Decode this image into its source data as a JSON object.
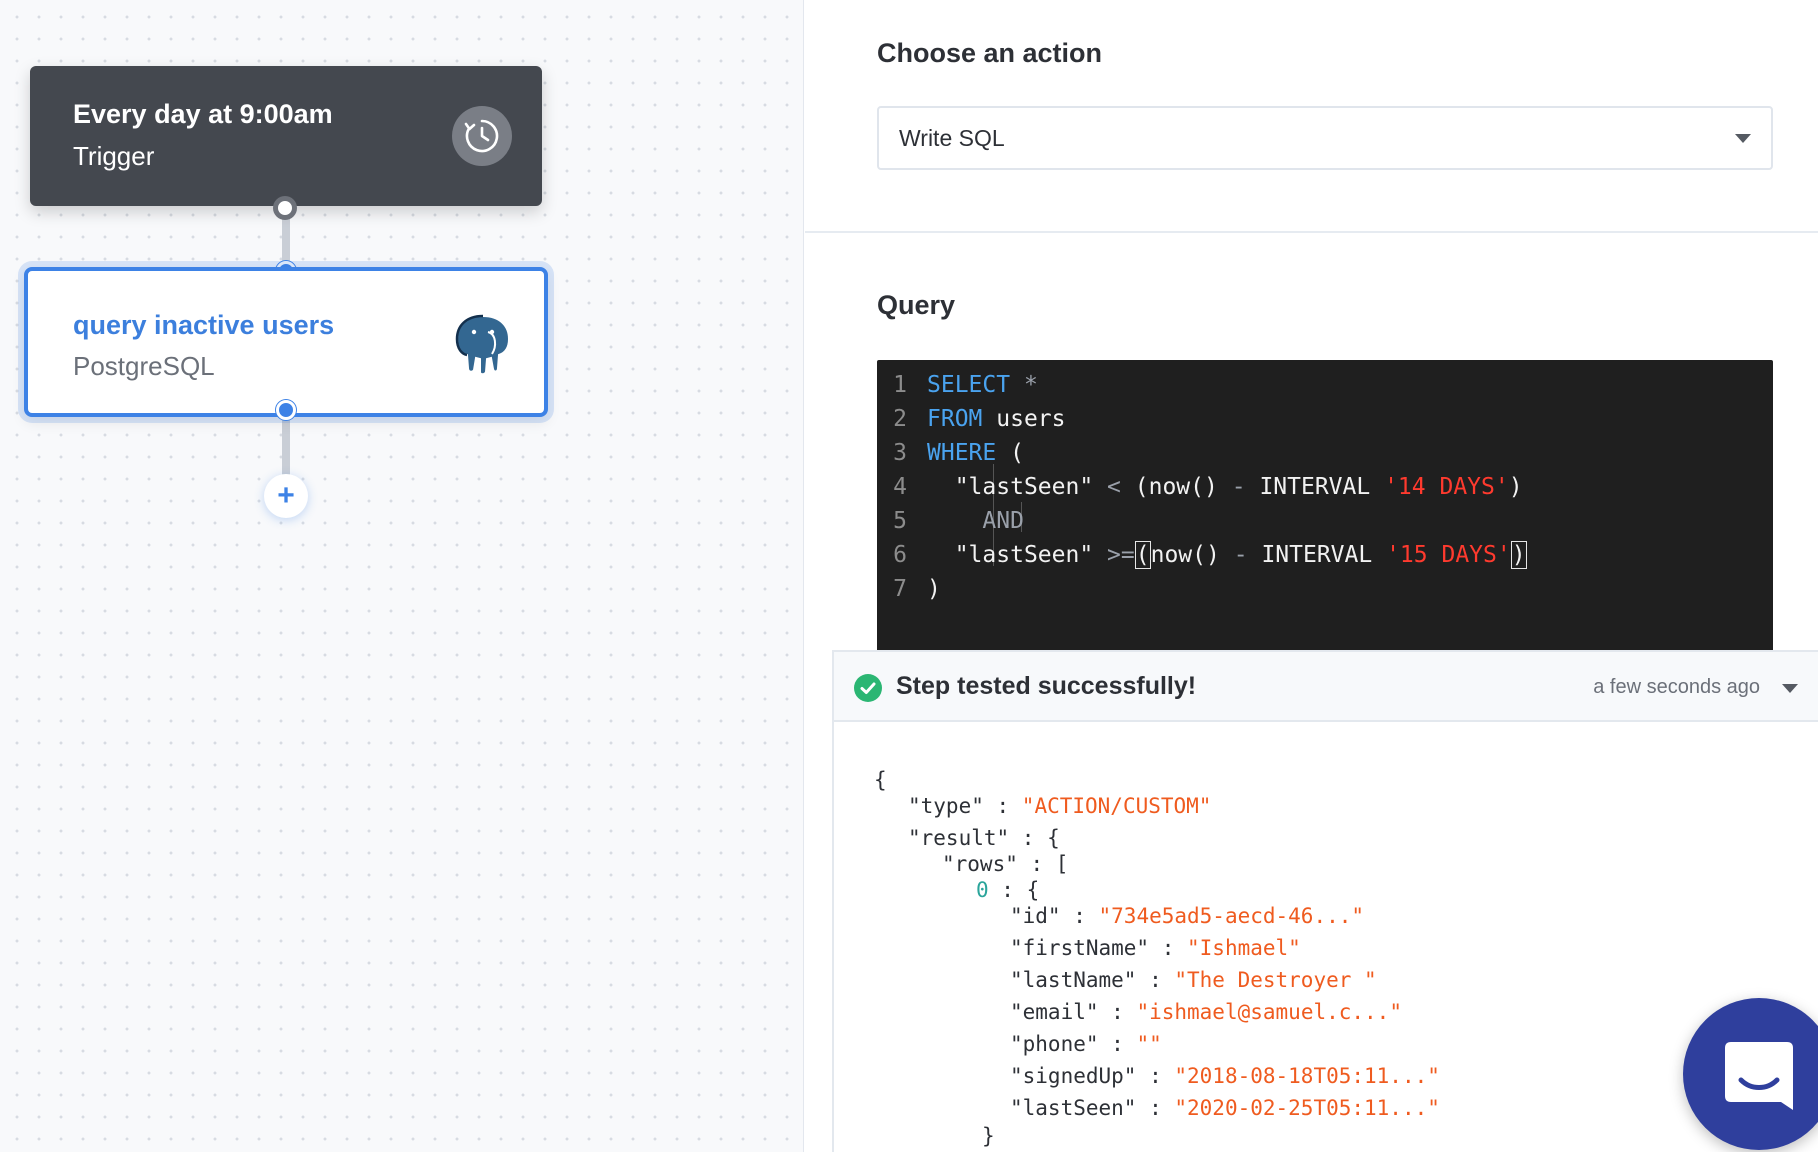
{
  "workflow": {
    "trigger": {
      "title": "Every day at 9:00am",
      "subtitle": "Trigger",
      "icon": "clock-icon"
    },
    "action": {
      "title": "query inactive users",
      "subtitle": "PostgreSQL",
      "icon": "postgresql-elephant-icon"
    },
    "add_step_icon": "+"
  },
  "panel": {
    "action_section_title": "Choose an action",
    "action_select_value": "Write SQL",
    "query_section_title": "Query",
    "code_line_numbers": [
      "1",
      "2",
      "3",
      "4",
      "5",
      "6",
      "7"
    ],
    "code": {
      "l1_kw": "SELECT",
      "l1_rest": "*",
      "l2_kw": "FROM",
      "l2_rest": "users",
      "l3_kw": "WHERE",
      "l3_rest": "(",
      "l4_col": "\"lastSeen\"",
      "l4_op": "<",
      "l4_expr": "(now()",
      "l4_minus": "-",
      "l4_interval": "INTERVAL",
      "l4_str": "'14 DAYS'",
      "l4_close": ")",
      "l5_and": "AND",
      "l6_col": "\"lastSeen\"",
      "l6_op": ">=",
      "l6_open": "(",
      "l6_expr": "now()",
      "l6_minus": "-",
      "l6_interval": "INTERVAL",
      "l6_str": "'15 DAYS'",
      "l6_close": ")",
      "l7": ")"
    },
    "result": {
      "status": "Step tested successfully!",
      "time": "a few seconds ago",
      "json": {
        "open_brace": "{",
        "type_key": "\"type\"",
        "type_value": "\"ACTION/CUSTOM\"",
        "result_key": "\"result\"",
        "rows_key": "\"rows\"",
        "row_index": "0",
        "fields": [
          {
            "key": "\"id\"",
            "value": "\"734e5ad5-aecd-46...\""
          },
          {
            "key": "\"firstName\"",
            "value": "\"Ishmael\""
          },
          {
            "key": "\"lastName\"",
            "value": "\"The Destroyer \""
          },
          {
            "key": "\"email\"",
            "value": "\"ishmael@samuel.c...\""
          },
          {
            "key": "\"phone\"",
            "value": "\"\""
          },
          {
            "key": "\"signedUp\"",
            "value": "\"2018-08-18T05:11...\""
          },
          {
            "key": "\"lastSeen\"",
            "value": "\"2020-02-25T05:11...\""
          }
        ],
        "close_brace": "}"
      }
    }
  },
  "chat_widget_icon": "chat-icon",
  "colors": {
    "accent": "#3d82e6",
    "trigger_card": "#44484f",
    "sql_keyword": "#4aa3ef",
    "sql_string": "#ff3a2e",
    "json_string": "#ef5b1f",
    "success": "#2bb673",
    "chat_button": "#2f3f9d"
  }
}
